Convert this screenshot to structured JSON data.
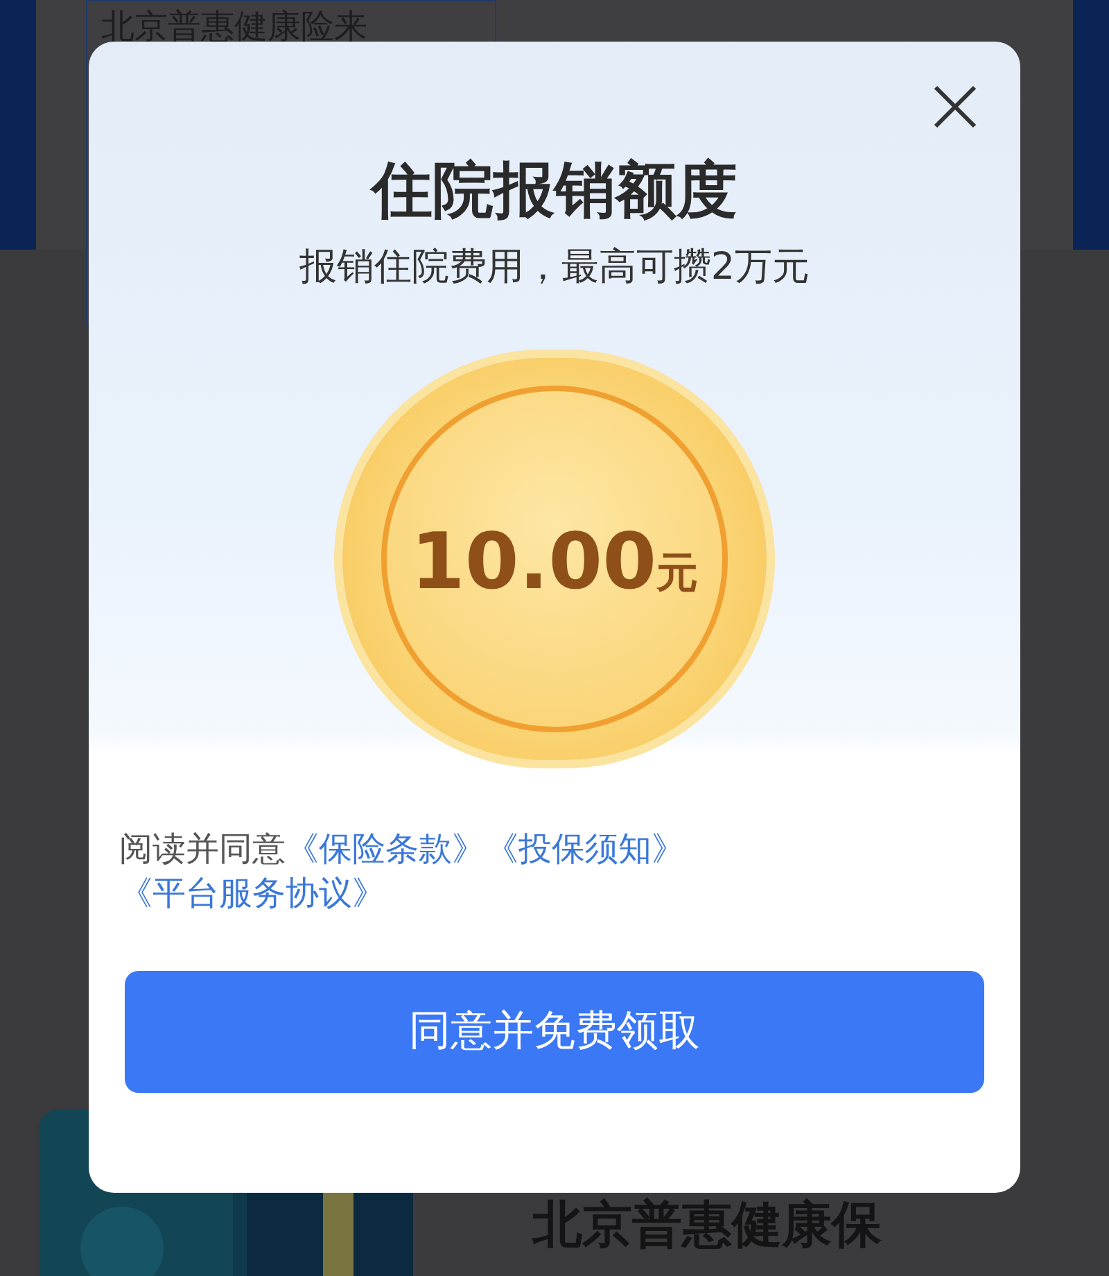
{
  "background_page": {
    "header_card_title": "北京普惠健康险来",
    "product_title": "北京普惠健康保"
  },
  "dialog": {
    "title": "住院报销额度",
    "subtitle": "报销住院费用，最高可攒2万元",
    "coin_amount": "10.00",
    "coin_unit": "元",
    "agreement": {
      "prefix": "阅读并同意",
      "links": [
        "《保险条款》",
        "《投保须知》",
        "《平台服务协议》"
      ]
    },
    "confirm_button": "同意并免费领取"
  }
}
